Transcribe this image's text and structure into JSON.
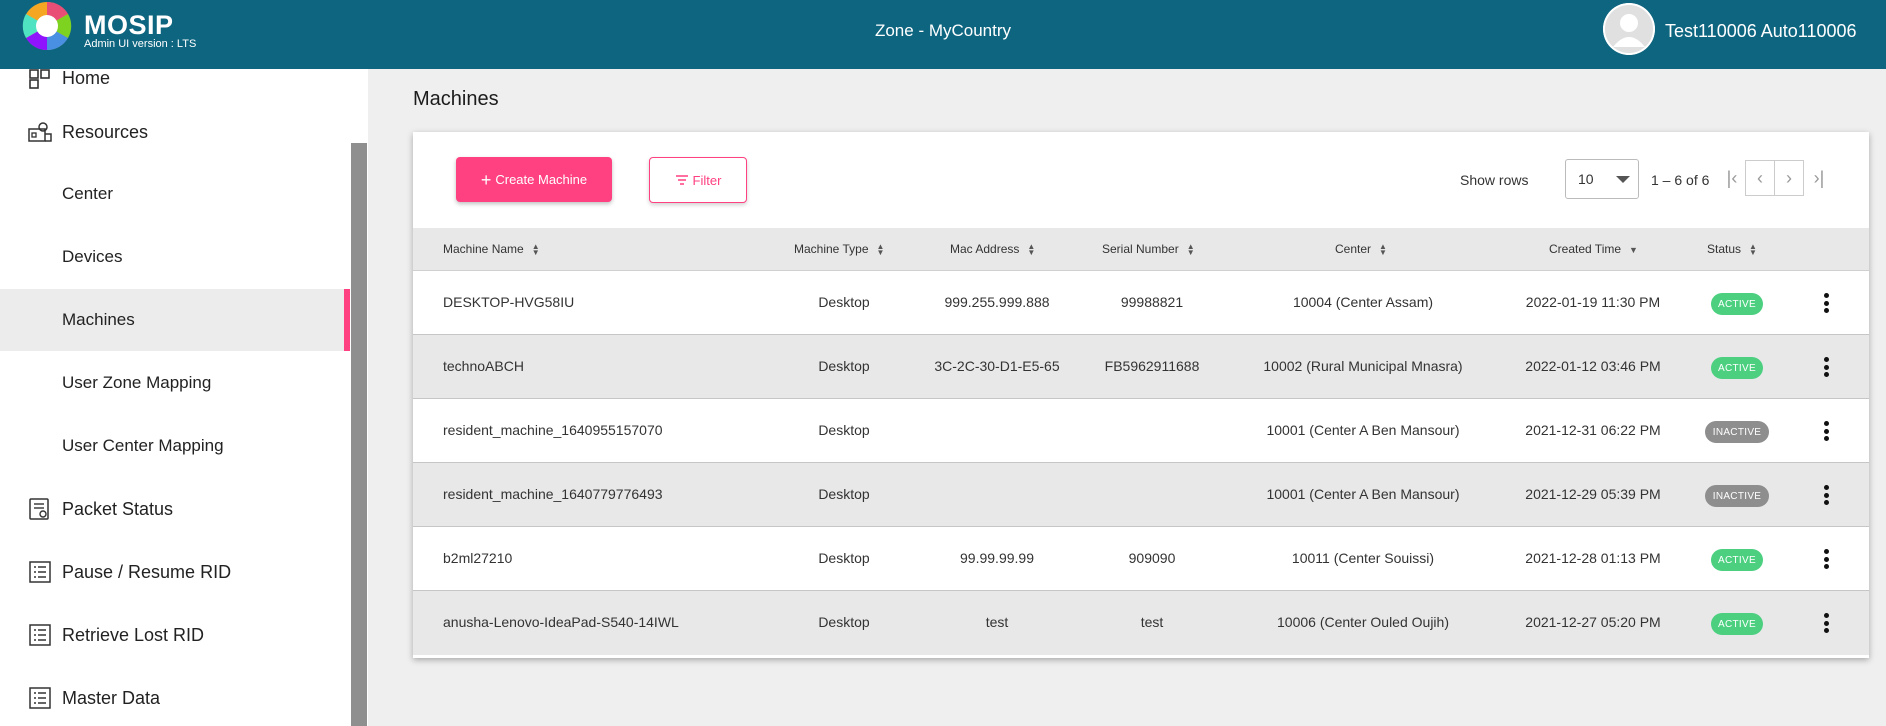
{
  "header": {
    "brand": "MOSIP",
    "version": "Admin UI version : LTS",
    "zone": "Zone - MyCountry",
    "user": "Test110006 Auto110006"
  },
  "sidebar": {
    "items": [
      {
        "label": "Home",
        "icon": "home-icon"
      },
      {
        "label": "Resources",
        "icon": "resources-icon"
      },
      {
        "label": "Center"
      },
      {
        "label": "Devices"
      },
      {
        "label": "Machines"
      },
      {
        "label": "User Zone Mapping"
      },
      {
        "label": "User Center Mapping"
      },
      {
        "label": "Packet Status",
        "icon": "packet-status-icon"
      },
      {
        "label": "Pause / Resume RID",
        "icon": "list-icon"
      },
      {
        "label": "Retrieve Lost RID",
        "icon": "list-icon"
      },
      {
        "label": "Master Data",
        "icon": "list-icon"
      }
    ]
  },
  "main": {
    "title": "Machines",
    "create_label": "Create Machine",
    "filter_label": "Filter",
    "show_rows_label": "Show rows",
    "rows_value": "10",
    "range": "1 – 6 of 6",
    "columns": [
      "Machine Name",
      "Machine Type",
      "Mac Address",
      "Serial Number",
      "Center",
      "Created Time",
      "Status"
    ],
    "rows": [
      {
        "name": "DESKTOP-HVG58IU",
        "type": "Desktop",
        "mac": "999.255.999.888",
        "serial": "99988821",
        "center": "10004 (Center Assam)",
        "created": "2022-01-19 11:30 PM",
        "status": "ACTIVE"
      },
      {
        "name": "technoABCH",
        "type": "Desktop",
        "mac": "3C-2C-30-D1-E5-65",
        "serial": "FB5962911688",
        "center": "10002 (Rural Municipal Mnasra)",
        "created": "2022-01-12 03:46 PM",
        "status": "ACTIVE"
      },
      {
        "name": "resident_machine_1640955157070",
        "type": "Desktop",
        "mac": "",
        "serial": "",
        "center": "10001 (Center A Ben Mansour)",
        "created": "2021-12-31 06:22 PM",
        "status": "INACTIVE"
      },
      {
        "name": "resident_machine_1640779776493",
        "type": "Desktop",
        "mac": "",
        "serial": "",
        "center": "10001 (Center A Ben Mansour)",
        "created": "2021-12-29 05:39 PM",
        "status": "INACTIVE"
      },
      {
        "name": "b2ml27210",
        "type": "Desktop",
        "mac": "99.99.99.99",
        "serial": "909090",
        "center": "10011 (Center Souissi)",
        "created": "2021-12-28 01:13 PM",
        "status": "ACTIVE"
      },
      {
        "name": "anusha-Lenovo-IdeaPad-S540-14IWL",
        "type": "Desktop",
        "mac": "test",
        "serial": "test",
        "center": "10006 (Center Ouled Oujih)",
        "created": "2021-12-27 05:20 PM",
        "status": "ACTIVE"
      }
    ]
  },
  "colors": {
    "header_bg": "#0e6580",
    "accent": "#ff4081",
    "active_badge": "#4cd080",
    "inactive_badge": "#8e8e8e"
  }
}
